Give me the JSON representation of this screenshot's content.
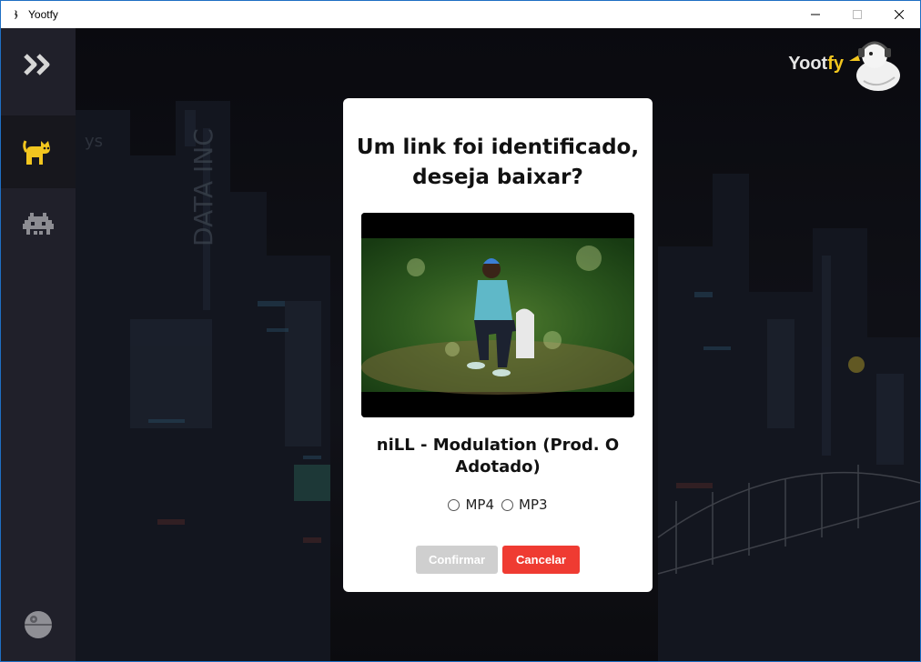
{
  "window": {
    "title": "Yootfy"
  },
  "brand": {
    "name_main": "Yoot",
    "name_accent": "fy"
  },
  "modal": {
    "title": "Um link foi identificado, deseja baixar?",
    "song_title": "niLL - Modulation (Prod. O Adotado)",
    "format_options": [
      "MP4",
      "MP3"
    ],
    "confirm_label": "Confirmar",
    "cancel_label": "Cancelar"
  },
  "sidebar": {
    "items": [
      {
        "icon": "double-chevron-right-icon"
      },
      {
        "icon": "cat-icon",
        "active": true
      },
      {
        "icon": "space-invader-icon"
      },
      {
        "icon": "death-star-icon"
      }
    ]
  },
  "colors": {
    "sidebar_bg": "#20202a",
    "accent_yellow": "#f2c61f",
    "cancel_red": "#ef3b32",
    "confirm_disabled": "#cfcfcf"
  }
}
